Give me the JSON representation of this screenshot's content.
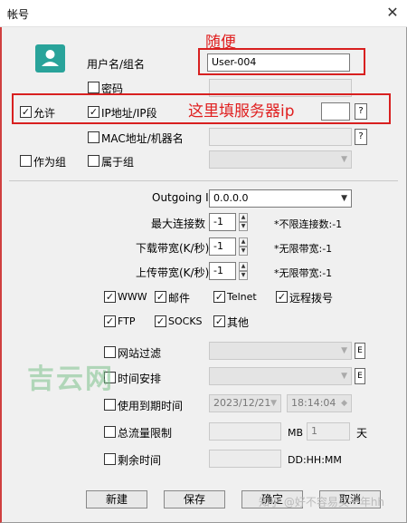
{
  "window": {
    "title": "帐号",
    "close_glyph": "✕"
  },
  "annotations": {
    "casual": "随便",
    "server_ip": "这里填服务器ip"
  },
  "account": {
    "username_label": "用户名/组名",
    "username_value": "User-004",
    "password_label": "密码",
    "allow_label": "允许",
    "allow_checked": true,
    "ip_label": "IP地址/IP段",
    "ip_checked": true,
    "mac_label": "MAC地址/机器名",
    "as_group_label": "作为组",
    "belongs_label": "属于组",
    "help_glyph": "?"
  },
  "network": {
    "outgoing_label": "Outgoing IP",
    "outgoing_value": "0.0.0.0",
    "max_conn_label": "最大连接数",
    "max_conn_value": "-1",
    "max_conn_note": "*不限连接数:-1",
    "down_label": "下载带宽(K/秒)",
    "down_value": "-1",
    "down_note": "*无限带宽:-1",
    "up_label": "上传带宽(K/秒)",
    "up_value": "-1",
    "up_note": "*无限带宽:-1"
  },
  "services": [
    {
      "label": "WWW",
      "checked": true
    },
    {
      "label": "邮件",
      "checked": true
    },
    {
      "label": "Telnet",
      "checked": true
    },
    {
      "label": "远程拨号",
      "checked": true
    },
    {
      "label": "FTP",
      "checked": true
    },
    {
      "label": "SOCKS",
      "checked": true
    },
    {
      "label": "其他",
      "checked": true
    }
  ],
  "limits": {
    "site_filter_label": "网站过滤",
    "schedule_label": "时间安排",
    "expire_label": "使用到期时间",
    "expire_date": "2023/12/21",
    "expire_time": "18:14:04",
    "traffic_label": "总流量限制",
    "traffic_unit": "MB",
    "traffic_days": "1",
    "traffic_day_unit": "天",
    "remain_label": "剩余时间",
    "remain_format": "DD:HH:MM",
    "e_glyph": "E"
  },
  "buttons": {
    "new": "新建",
    "save": "保存",
    "ok": "确定",
    "cancel": "取消"
  },
  "watermarks": {
    "site": "吉云网",
    "zhihu": "知乎 @好不容易买一年hh"
  },
  "colors": {
    "accent_red": "#d82020",
    "avatar": "#29a39a"
  }
}
